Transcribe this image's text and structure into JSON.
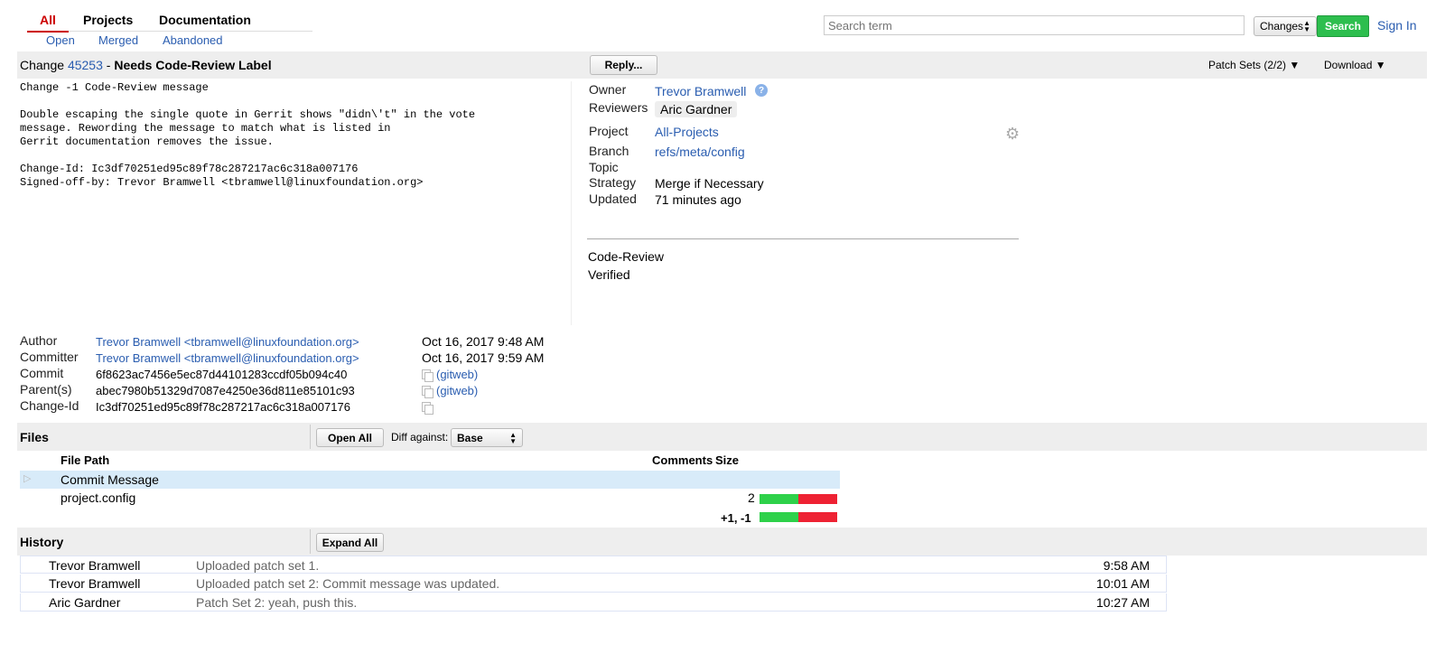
{
  "nav": {
    "tabs": [
      {
        "label": "All",
        "active": true
      },
      {
        "label": "Projects"
      },
      {
        "label": "Documentation"
      }
    ],
    "subtabs": [
      "Open",
      "Merged",
      "Abandoned"
    ]
  },
  "search": {
    "placeholder": "Search term",
    "scope": "Changes",
    "button": "Search",
    "sign_in": "Sign In"
  },
  "change": {
    "prefix": "Change",
    "number": "45253",
    "separator": "-",
    "title": "Needs Code-Review Label",
    "reply_button": "Reply...",
    "patch_sets": "Patch Sets (2/2)",
    "download": "Download",
    "commit_message": "Change -1 Code-Review message\n\nDouble escaping the single quote in Gerrit shows \"didn\\'t\" in the vote\nmessage. Rewording the message to match what is listed in\nGerrit documentation removes the issue.\n\nChange-Id: Ic3df70251ed95c89f78c287217ac6c318a007176\nSigned-off-by: Trevor Bramwell <tbramwell@linuxfoundation.org>"
  },
  "info": {
    "owner_label": "Owner",
    "owner": "Trevor Bramwell",
    "reviewers_label": "Reviewers",
    "reviewer": "Aric Gardner",
    "project_label": "Project",
    "project": "All-Projects",
    "branch_label": "Branch",
    "branch": "refs/meta/config",
    "topic_label": "Topic",
    "strategy_label": "Strategy",
    "strategy": "Merge if Necessary",
    "updated_label": "Updated",
    "updated": "71 minutes ago",
    "labels": [
      "Code-Review",
      "Verified"
    ]
  },
  "commit_meta": {
    "author_label": "Author",
    "author": "Trevor Bramwell <tbramwell@linuxfoundation.org>",
    "author_date": "Oct 16, 2017 9:48 AM",
    "committer_label": "Committer",
    "committer": "Trevor Bramwell <tbramwell@linuxfoundation.org>",
    "committer_date": "Oct 16, 2017 9:59 AM",
    "commit_label": "Commit",
    "commit": "6f8623ac7456e5ec87d44101283ccdf05b094c40",
    "parent_label": "Parent(s)",
    "parent": "abec7980b51329d7087e4250e36d811e85101c93",
    "changeid_label": "Change-Id",
    "changeid": "Ic3df70251ed95c89f78c287217ac6c318a007176",
    "gitweb": "(gitweb)"
  },
  "files": {
    "section_title": "Files",
    "open_all": "Open All",
    "diff_against_label": "Diff against:",
    "diff_against_value": "Base",
    "col_path": "File Path",
    "col_comments": "Comments",
    "col_size": "Size",
    "rows": [
      {
        "path": "Commit Message",
        "size": "",
        "added": 0,
        "deleted": 0
      },
      {
        "path": "project.config",
        "size": "2",
        "added": 1,
        "deleted": 1
      }
    ],
    "total": "+1, -1",
    "colors": {
      "added": "#2ed14a",
      "deleted": "#ee2233"
    }
  },
  "history": {
    "section_title": "History",
    "expand_all": "Expand All",
    "rows": [
      {
        "author": "Trevor Bramwell",
        "message": "Uploaded patch set 1.",
        "time": "9:58 AM"
      },
      {
        "author": "Trevor Bramwell",
        "message": "Uploaded patch set 2: Commit message was updated.",
        "time": "10:01 AM"
      },
      {
        "author": "Aric Gardner",
        "message": "Patch Set 2: yeah, push this.",
        "time": "10:27 AM"
      }
    ]
  }
}
